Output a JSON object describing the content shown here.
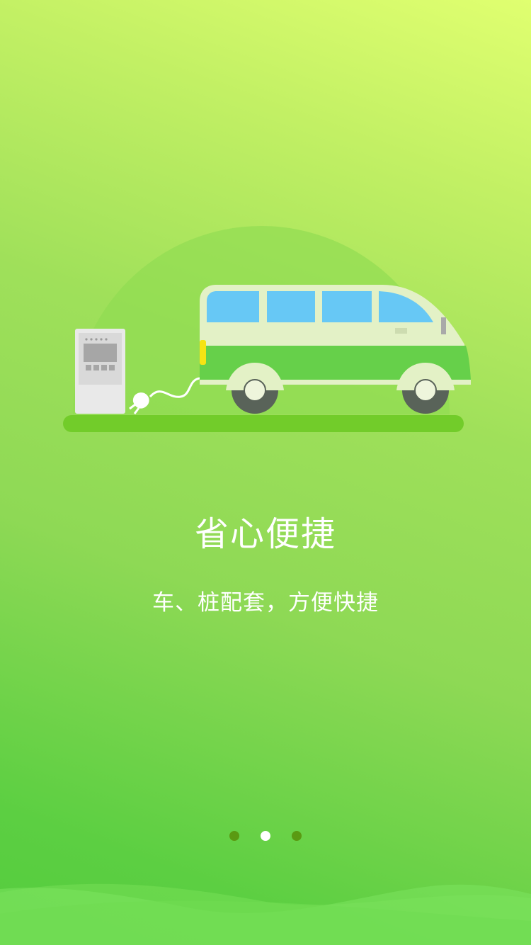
{
  "onboarding": {
    "title": "省心便捷",
    "subtitle": "车、桩配套，方便快捷",
    "current_page": 2,
    "total_pages": 3
  },
  "illustration": {
    "subject": "electric-van-charging",
    "icons": [
      "charging-station-icon",
      "plug-icon",
      "electric-van-icon"
    ]
  },
  "colors": {
    "background_top": "#e0ff70",
    "background_bottom": "#54cc3e",
    "ground": "#72cc2a",
    "van_body": "#66d04a",
    "van_window": "#67c8f5",
    "indicator_active": "#ffffff",
    "indicator_inactive": "#5a9a12"
  }
}
